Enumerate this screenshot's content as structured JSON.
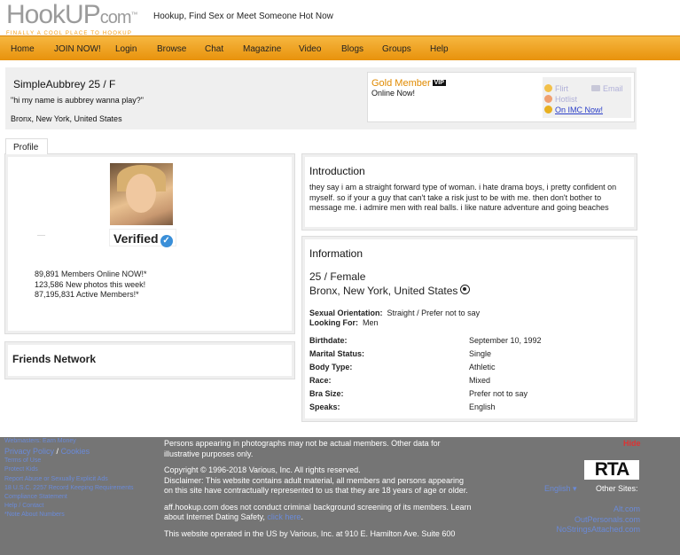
{
  "header": {
    "logo_text": "HookUP",
    "logo_suffix": "com",
    "logo_tagline": "FINALLY A COOL PLACE TO HOOKUP",
    "tagline": "Hookup, Find Sex or Meet Someone Hot Now"
  },
  "nav": {
    "items": [
      "Home",
      "JOIN NOW!",
      "Login",
      "Browse",
      "Chat",
      "Magazine",
      "Video",
      "Blogs",
      "Groups",
      "Help"
    ]
  },
  "profile": {
    "name_age_sex": "SimpleAubbrey 25 / F",
    "quote": "\"hi my name is aubbrey wanna play?\"",
    "location": "Bronx, New York, United States",
    "membership": "Gold Member",
    "vip_badge": "VIP",
    "online_status": "Online Now!",
    "actions": {
      "flirt": "Flirt",
      "email": "Email",
      "hotlist": "Hotlist",
      "imc": "On IMC Now!"
    },
    "tab_label": "Profile",
    "verified_label": "Verified",
    "dash": "__",
    "stats": [
      "89,891 Members Online NOW!*",
      "123,586 New photos this week!",
      "87,195,831 Active Members!*"
    ],
    "friends_title": "Friends Network"
  },
  "introduction": {
    "title": "Introduction",
    "text": "they say i am a straight forward type of woman. i hate drama boys, i pretty confident on myself. so if your a guy that can't take a risk just to be with me. then don't bother to message me. i admire men with real balls. i like nature adventure and going beaches"
  },
  "information": {
    "title": "Information",
    "age_sex": "25 / Female",
    "location": "Bronx, New York, United States",
    "orientation_label": "Sexual Orientation:",
    "orientation_value": "Straight / Prefer not to say",
    "looking_label": "Looking For:",
    "looking_value": "Men",
    "rows": [
      {
        "label": "Birthdate:",
        "value": "September 10, 1992"
      },
      {
        "label": "Marital Status:",
        "value": "Single"
      },
      {
        "label": "Body Type:",
        "value": "Athletic"
      },
      {
        "label": "Race:",
        "value": "Mixed"
      },
      {
        "label": "Bra Size:",
        "value": "Prefer not to say"
      },
      {
        "label": "Speaks:",
        "value": "English"
      }
    ]
  },
  "footer": {
    "links": [
      "Webmasters: Earn Money",
      "Privacy Policy",
      "Cookies",
      "Terms of Use",
      "Protect Kids",
      "Report Abuse or Sexually Explicit Ads",
      "18 U.S.C. 2257 Record Keeping Requirements",
      "Compliance Statement",
      "Help / Contact",
      "*Note About Numbers"
    ],
    "disclaimer1": "Persons appearing in photographs may not be actual members. Other data for illustrative purposes only.",
    "copyright": "Copyright © 1996-2018 Various, Inc. All rights reserved.",
    "disclaimer2": "Disclaimer: This website contains adult material, all members and persons appearing on this site have contractually represented to us that they are 18 years of age or older.",
    "screening": "aff.hookup.com does not conduct criminal background screening of its members. Learn about Internet Dating Safety,",
    "click_here": "click here",
    "operated": "This website operated in the US by Various, Inc. at 910 E. Hamilton Ave. Suite 600",
    "hide": "Hide",
    "rta": "RTA",
    "language": "English",
    "other_sites_label": "Other Sites:",
    "other_sites": [
      "Alt.com",
      "OutPersonals.com",
      "NoStringsAttached.com"
    ]
  }
}
